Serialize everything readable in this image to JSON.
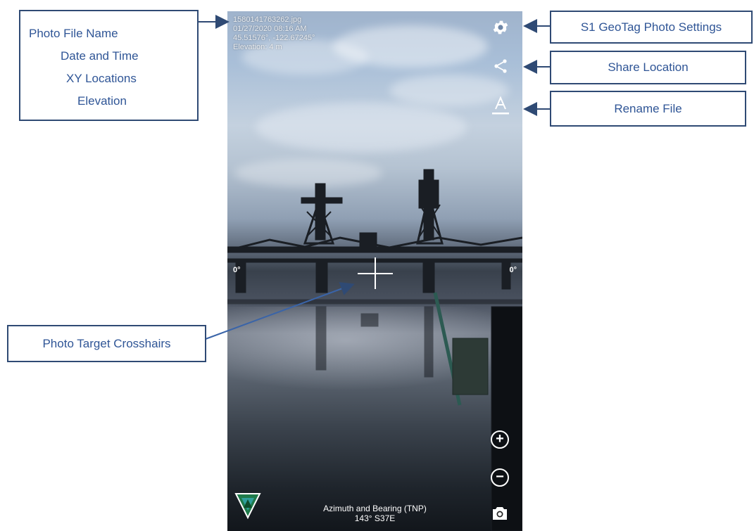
{
  "photo_overlay": {
    "file_name": "1580141763262.jpg",
    "date_time": "01/27/2020 08:16 AM",
    "xy_location": "45.51576°, -122.67245°",
    "elevation": "Elevation: 4 m"
  },
  "horizon": {
    "left_degree": "0°",
    "right_degree": "0°"
  },
  "bottom": {
    "azimuth_label": "Azimuth and Bearing (TNP)",
    "azimuth_value": "143° S37E"
  },
  "controls": {
    "settings_icon": "gear-icon",
    "share_icon": "share-icon",
    "rename_icon": "rename-a-icon",
    "zoom_in_icon": "plus-circle-icon",
    "zoom_out_icon": "minus-circle-icon",
    "camera_icon": "camera-icon"
  },
  "callouts": {
    "overlay_info": {
      "line1": "Photo File Name",
      "line2": "Date and Time",
      "line3": "XY Locations",
      "line4": "Elevation"
    },
    "settings": "S1 GeoTag Photo Settings",
    "share": "Share Location",
    "rename": "Rename File",
    "crosshairs": "Photo Target Crosshairs"
  },
  "colors": {
    "callout_border": "#2f4a74",
    "callout_text": "#2f5596",
    "arrow": "#2f4a74"
  }
}
